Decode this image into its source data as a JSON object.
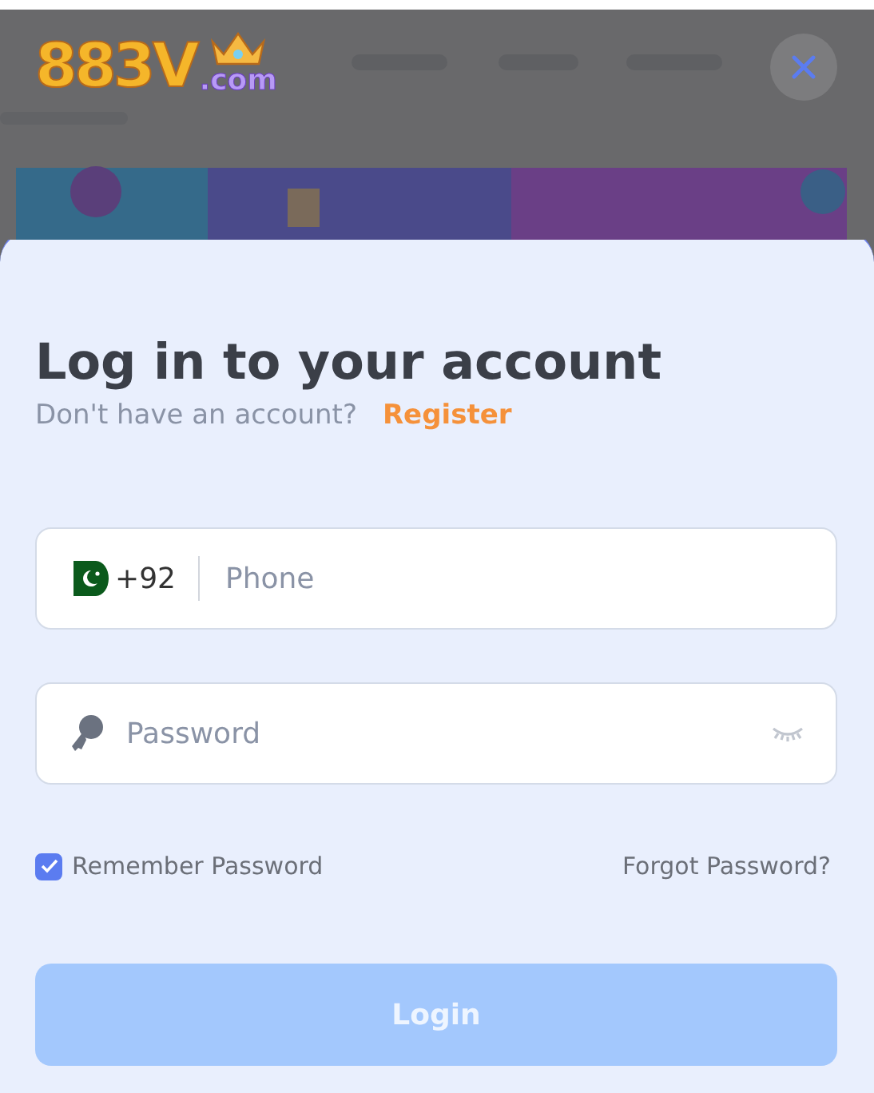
{
  "header": {
    "logo": {
      "number": "883V",
      "suffix": ".com"
    }
  },
  "dialog": {
    "title": "Log in to your account",
    "prompt": "Don't have an account?",
    "register_link": "Register",
    "phone": {
      "country_code": "+92",
      "placeholder": "Phone"
    },
    "password": {
      "placeholder": "Password"
    },
    "remember": {
      "label": "Remember Password",
      "checked": true
    },
    "forgot_link": "Forgot Password?",
    "login_button": {
      "label": "Login",
      "disabled": true
    }
  }
}
